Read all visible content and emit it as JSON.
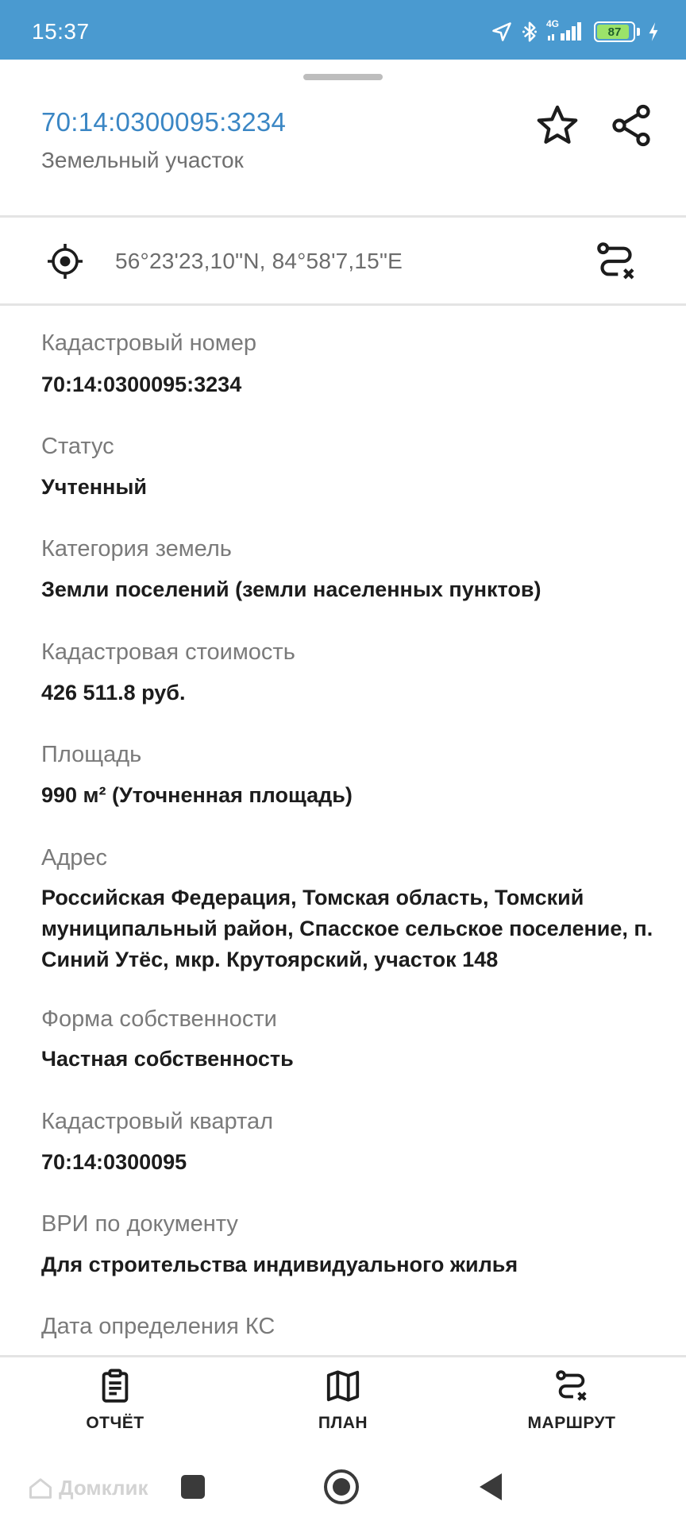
{
  "status_bar": {
    "time": "15:37",
    "network": "4G",
    "battery_level": "87",
    "icons": [
      "location-arrow-icon",
      "bluetooth-icon",
      "signal-icon",
      "battery-icon",
      "charging-icon"
    ]
  },
  "header": {
    "title": "70:14:0300095:3234",
    "subtitle": "Земельный участок",
    "favorite_icon": "star-icon",
    "share_icon": "share-icon",
    "title_color": "#3a86c4"
  },
  "coordinates": {
    "text": "56°23'23,10\"N, 84°58'7,15\"E",
    "locate_icon": "crosshair-icon",
    "route_icon": "route-icon"
  },
  "fields": [
    {
      "label": "Кадастровый номер",
      "value": "70:14:0300095:3234"
    },
    {
      "label": "Статус",
      "value": "Учтенный"
    },
    {
      "label": "Категория земель",
      "value": "Земли поселений (земли населенных пунктов)"
    },
    {
      "label": "Кадастровая стоимость",
      "value": "426 511.8 руб."
    },
    {
      "label": "Площадь",
      "value": "990 м² (Уточненная площадь)"
    },
    {
      "label": "Адрес",
      "value": "Российская Федерация, Томская область, Томский муниципальный район, Спасское сельское поселение, п. Синий Утёс, мкр. Крутоярский, участок 148"
    },
    {
      "label": "Форма собственности",
      "value": "Частная собственность"
    },
    {
      "label": "Кадастровый квартал",
      "value": "70:14:0300095"
    },
    {
      "label": "ВРИ по документу",
      "value": "Для строительства индивидуального жилья"
    },
    {
      "label": "Дата определения КС",
      "value": ""
    }
  ],
  "toolbar": {
    "report_label": "ОТЧЁТ",
    "plan_label": "ПЛАН",
    "route_label": "МАРШРУТ"
  },
  "watermark": "Домклик",
  "colors": {
    "status_bar": "#4a9ad0",
    "accent": "#3a86c4",
    "battery": "#9be36a"
  }
}
